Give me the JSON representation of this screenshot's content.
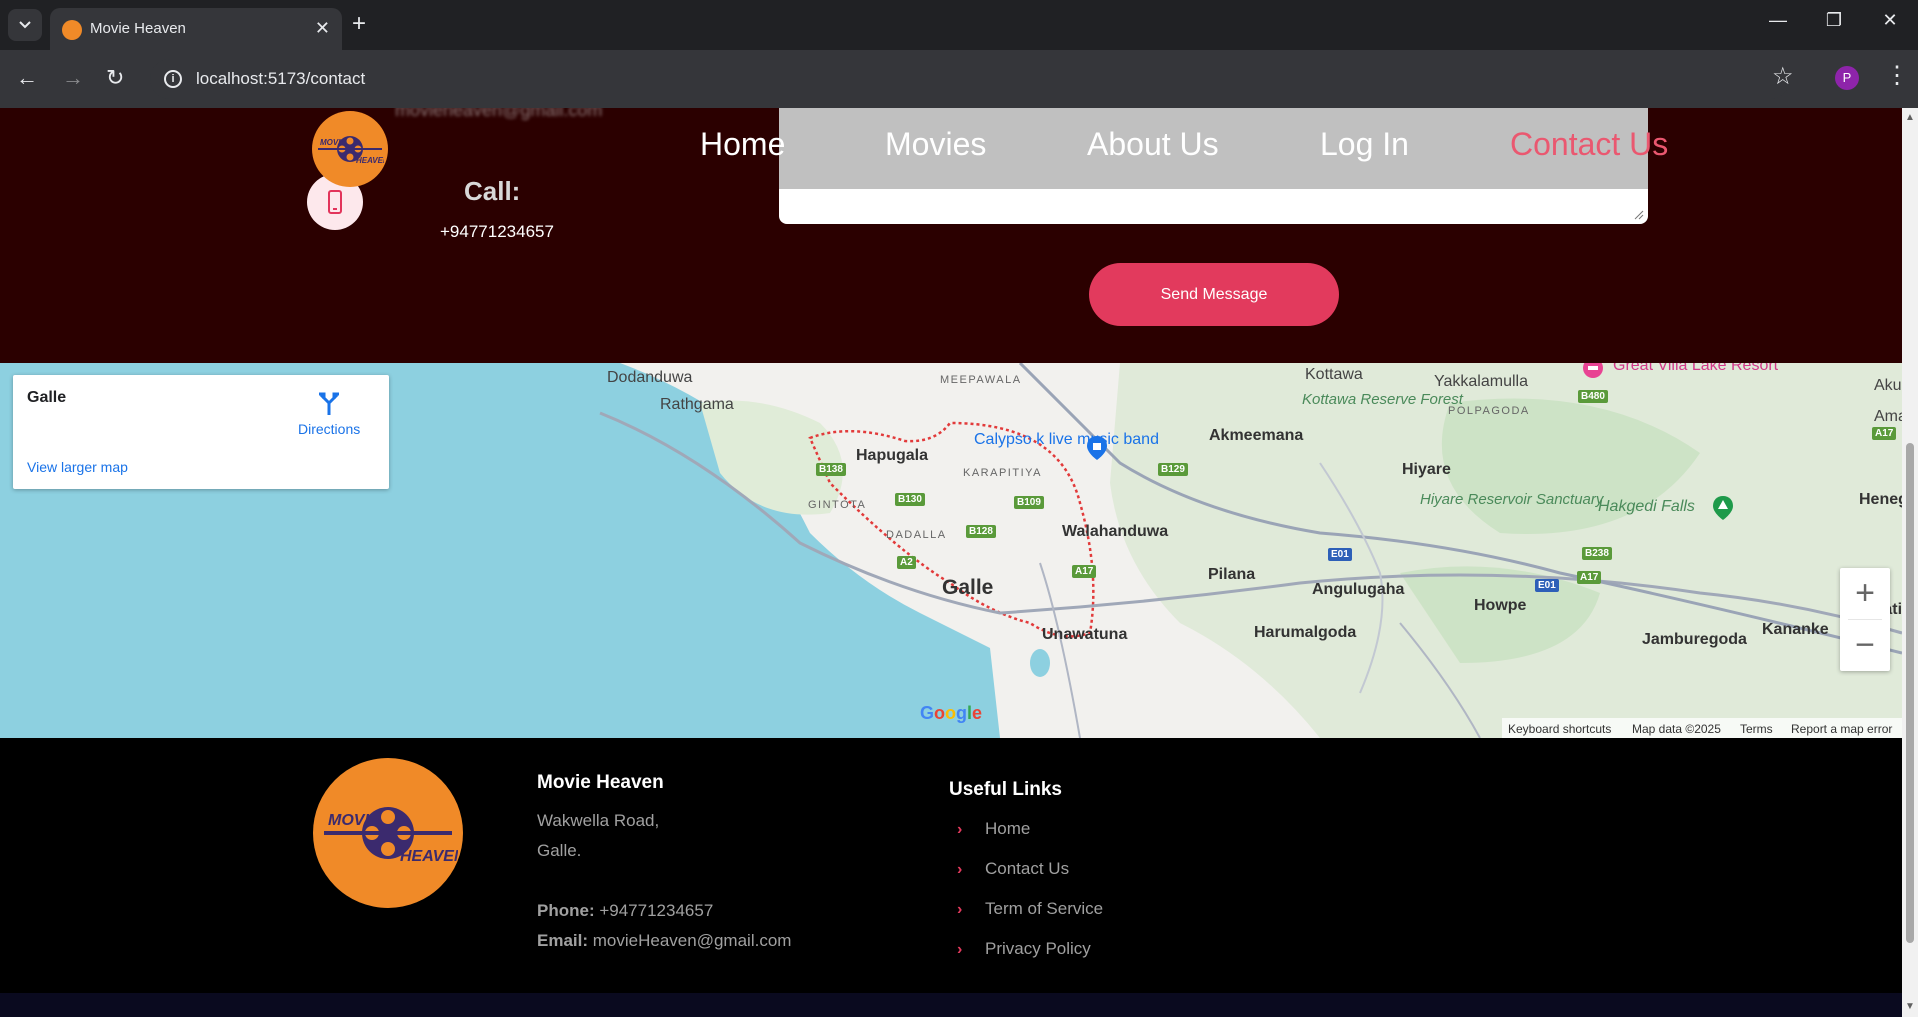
{
  "browser": {
    "tab_title": "Movie Heaven",
    "url": "localhost:5173/contact",
    "profile_initial": "P"
  },
  "nav": {
    "items": [
      {
        "label": "Home"
      },
      {
        "label": "Movies"
      },
      {
        "label": "About Us"
      },
      {
        "label": "Log In"
      },
      {
        "label": "Contact Us",
        "active": true
      }
    ],
    "active_color": "#ea5870"
  },
  "contact": {
    "call_label": "Call:",
    "call_number": "+94771234657",
    "send_button": "Send Message",
    "accent_color": "#e23a5d"
  },
  "map": {
    "place_name": "Galle",
    "directions_label": "Directions",
    "larger_map_label": "View larger map",
    "places": {
      "dodanduwa": "Dodanduwa",
      "rathgama": "Rathgama",
      "meepawala": "MEEPAWALA",
      "kottawa": "Kottawa",
      "yakkalamulla": "Yakkalamulla",
      "great_villa": "Great Villa Lake Resort",
      "aku": "Aku",
      "kottawa_forest": "Kottawa Reserve Forest",
      "polpagoda": "POLPAGODA",
      "ama": "Ama",
      "hapugala": "Hapugala",
      "calypso": "Calypso k live music band",
      "akmeemana": "Akmeemana",
      "karapitiya": "KARAPITIYA",
      "hiyare": "Hiyare",
      "gintota": "GINTOTA",
      "hiyare_reservoir": "Hiyare Reservoir Sanctuary",
      "hakgedi": "Hakgedi Falls",
      "heneg": "Heneg",
      "walahanduwa": "Walahanduwa",
      "dadalla": "DADALLA",
      "galle": "Galle",
      "pilana": "Pilana",
      "angulugaha": "Angulugaha",
      "howpe": "Howpe",
      "panati": "Panati",
      "kananke": "Kananke",
      "unawatuna": "Unawatuna",
      "harumalgoda": "Harumalgoda",
      "jamburegoda": "Jamburegoda"
    },
    "roads": {
      "b138": "B138",
      "b130": "B130",
      "b109": "B109",
      "b128": "B128",
      "a2": "A2",
      "a17a": "A17",
      "a17b": "A17",
      "a17c": "A17",
      "b129": "B129",
      "b480": "B480",
      "b238": "B238",
      "e01a": "E01",
      "e01b": "E01"
    },
    "google_logo": "Google",
    "attribution": {
      "keyboard": "Keyboard shortcuts",
      "data": "Map data ©2025",
      "terms": "Terms",
      "report": "Report a map error"
    }
  },
  "footer": {
    "brand": "Movie Heaven",
    "address_line1": "Wakwella Road,",
    "address_line2": "Galle.",
    "phone_label": "Phone:",
    "phone": "+94771234657",
    "email_label": "Email:",
    "email": "movieHeaven@gmail.com",
    "useful_title": "Useful Links",
    "links": [
      {
        "label": "Home"
      },
      {
        "label": "Contact Us"
      },
      {
        "label": "Term of Service"
      },
      {
        "label": "Privacy Policy"
      }
    ]
  },
  "logo": {
    "line1": "MOVIE",
    "line2": "HEAVEN"
  }
}
